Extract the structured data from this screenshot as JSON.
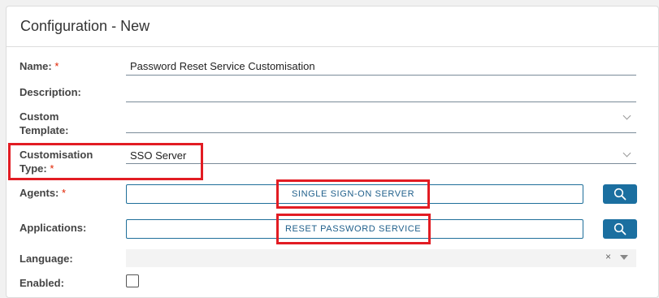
{
  "panel": {
    "title": "Configuration - New"
  },
  "fields": {
    "name": {
      "label": "Name:",
      "required": "*",
      "value": "Password Reset Service Customisation"
    },
    "description": {
      "label": "Description:",
      "value": ""
    },
    "custom_template": {
      "label_line1": "Custom",
      "label_line2": "Template:",
      "value": ""
    },
    "customisation_type": {
      "label_line1": "Customisation",
      "label_line2": "Type:",
      "required": "*",
      "value": "SSO Server"
    },
    "agents": {
      "label": "Agents:",
      "required": "*",
      "chip": "SINGLE SIGN-ON SERVER"
    },
    "applications": {
      "label": "Applications:",
      "chip": "RESET PASSWORD SERVICE"
    },
    "language": {
      "label": "Language:",
      "clear_glyph": "×"
    },
    "enabled": {
      "label": "Enabled:",
      "checked": false
    }
  },
  "colors": {
    "accent": "#1b6fa0",
    "highlight": "#e21c23",
    "required": "#e12200"
  }
}
